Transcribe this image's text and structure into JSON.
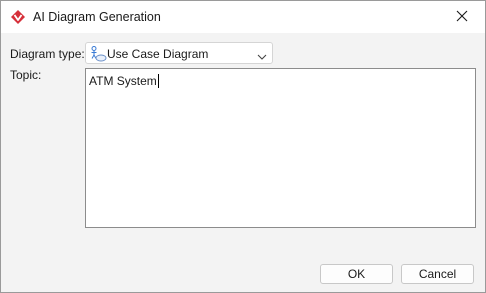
{
  "window": {
    "title": "AI Diagram Generation",
    "icon": "visual-paradigm-logo-icon",
    "close_icon": "close-icon"
  },
  "form": {
    "diagram_type_label": "Diagram type:",
    "diagram_type_value": "Use Case Diagram",
    "diagram_type_icon": "use-case-diagram-icon",
    "topic_label": "Topic:",
    "topic_value": "ATM System"
  },
  "buttons": {
    "ok_label": "OK",
    "cancel_label": "Cancel"
  },
  "colors": {
    "brand_red": "#d6303a",
    "dialog_bg": "#f3f3f3",
    "titlebar_bg": "#ffffff"
  }
}
